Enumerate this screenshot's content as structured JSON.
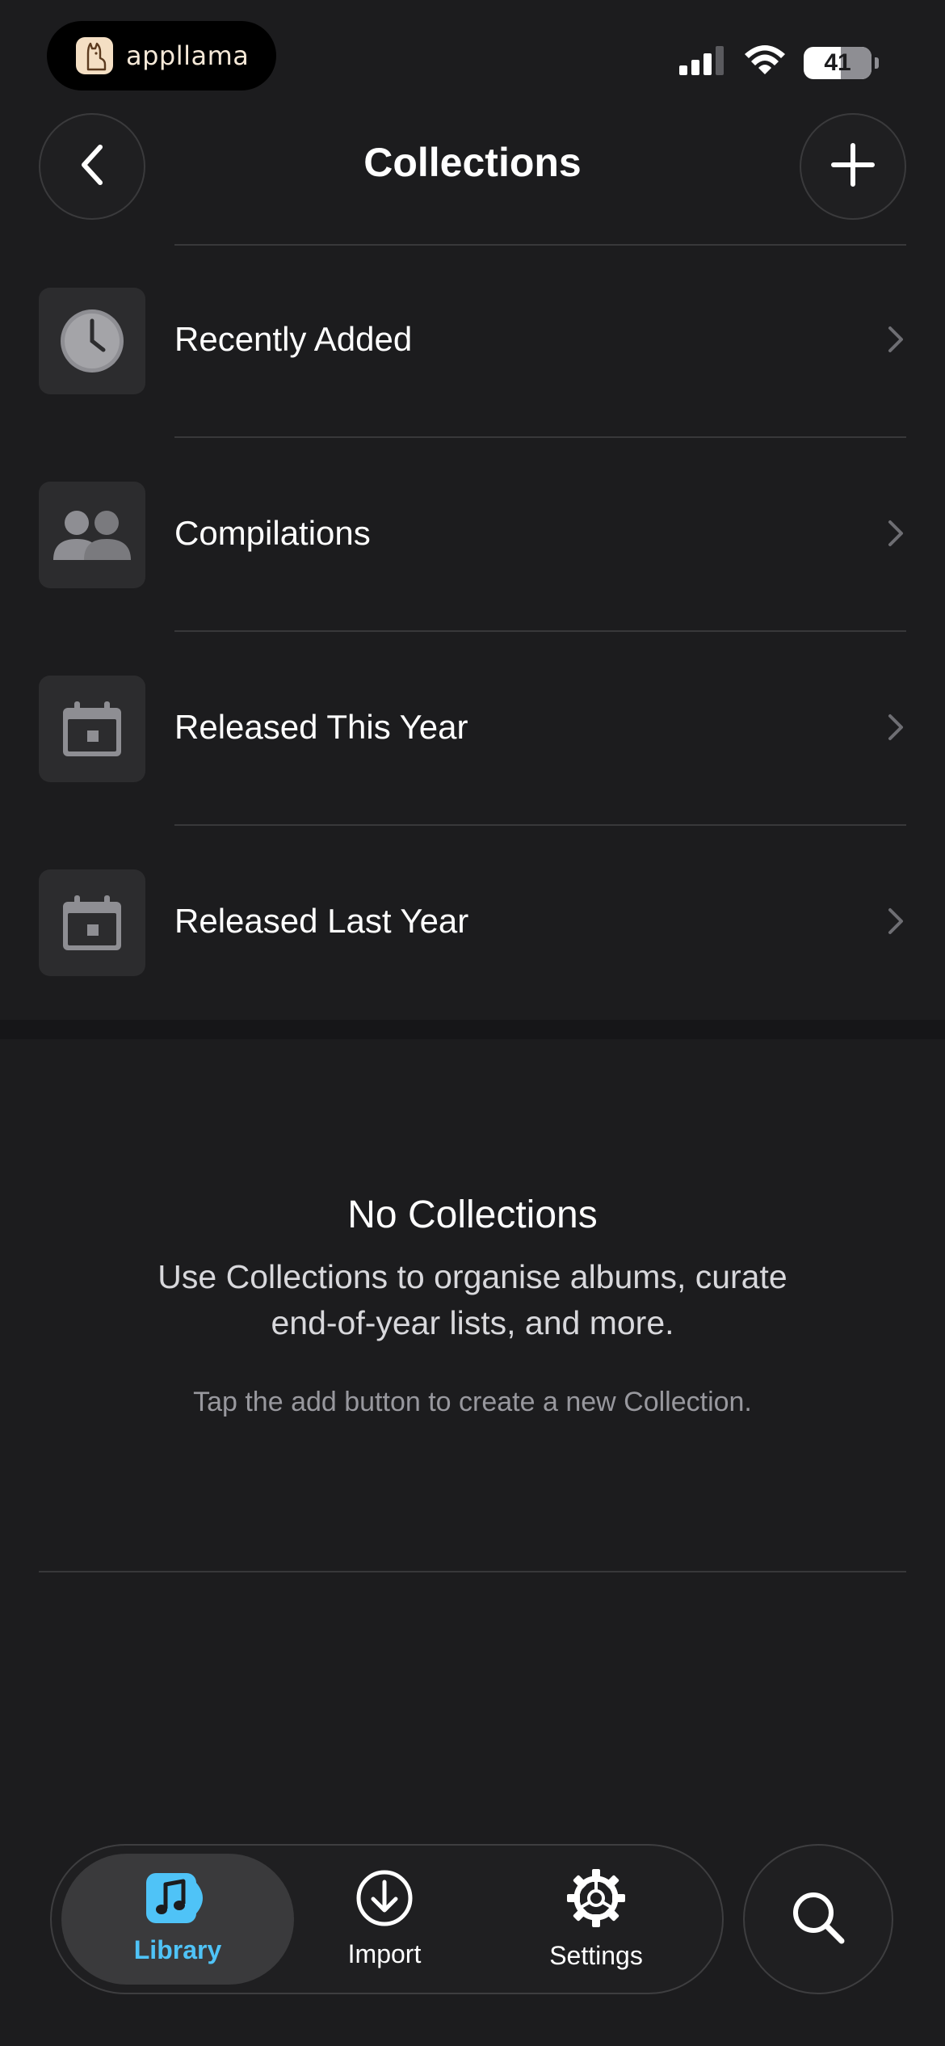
{
  "status_bar": {
    "app_name": "appllama",
    "battery_level": "41",
    "battery_fraction": 0.41
  },
  "nav": {
    "title": "Collections",
    "back_icon": "chevron-left-icon",
    "add_icon": "plus-icon"
  },
  "smart_collections": [
    {
      "label": "Recently Added",
      "icon": "clock-icon"
    },
    {
      "label": "Compilations",
      "icon": "people-icon"
    },
    {
      "label": "Released This Year",
      "icon": "calendar-icon"
    },
    {
      "label": "Released Last Year",
      "icon": "calendar-icon"
    }
  ],
  "empty_state": {
    "title": "No Collections",
    "body": "Use Collections to organise albums, curate end-of-year lists, and more.",
    "hint": "Tap the add button to create a new Collection."
  },
  "tab_bar": {
    "tabs": [
      {
        "label": "Library",
        "icon": "music-note-icon",
        "active": true
      },
      {
        "label": "Import",
        "icon": "download-icon",
        "active": false
      },
      {
        "label": "Settings",
        "icon": "gear-icon",
        "active": false
      }
    ],
    "search_icon": "search-icon"
  },
  "colors": {
    "background": "#1c1c1e",
    "accent": "#4fc3f7",
    "separator": "#38383a"
  }
}
